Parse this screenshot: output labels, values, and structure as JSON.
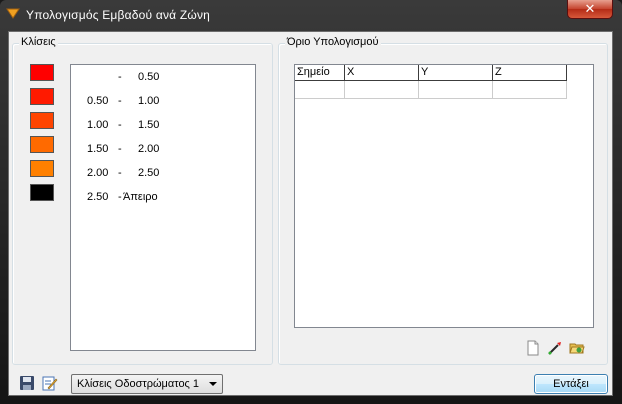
{
  "window": {
    "title": "Υπολογισμός Εμβαδού ανά Ζώνη",
    "close_symbol": "✕"
  },
  "classes_group": {
    "label": "Κλίσεις",
    "swatch_colors": [
      "#ff0000",
      "#ff1a00",
      "#ff4400",
      "#ff6a00",
      "#ff8000",
      "#000000"
    ],
    "rows": [
      {
        "from": "",
        "sep": "-",
        "to": "0.50"
      },
      {
        "from": "0.50",
        "sep": "-",
        "to": "1.00"
      },
      {
        "from": "1.00",
        "sep": "-",
        "to": "1.50"
      },
      {
        "from": "1.50",
        "sep": "-",
        "to": "2.00"
      },
      {
        "from": "2.00",
        "sep": "-",
        "to": "2.50"
      },
      {
        "from": "2.50",
        "sep": "-",
        "to": "Άπειρο"
      }
    ]
  },
  "boundary_group": {
    "label": "Όριο Υπολογισμού",
    "columns": [
      "Σημείο",
      "X",
      "Y",
      "Z"
    ]
  },
  "footer": {
    "dropdown_value": "Κλίσεις Οδοστρώματος 1",
    "ok_label": "Εντάξει"
  }
}
